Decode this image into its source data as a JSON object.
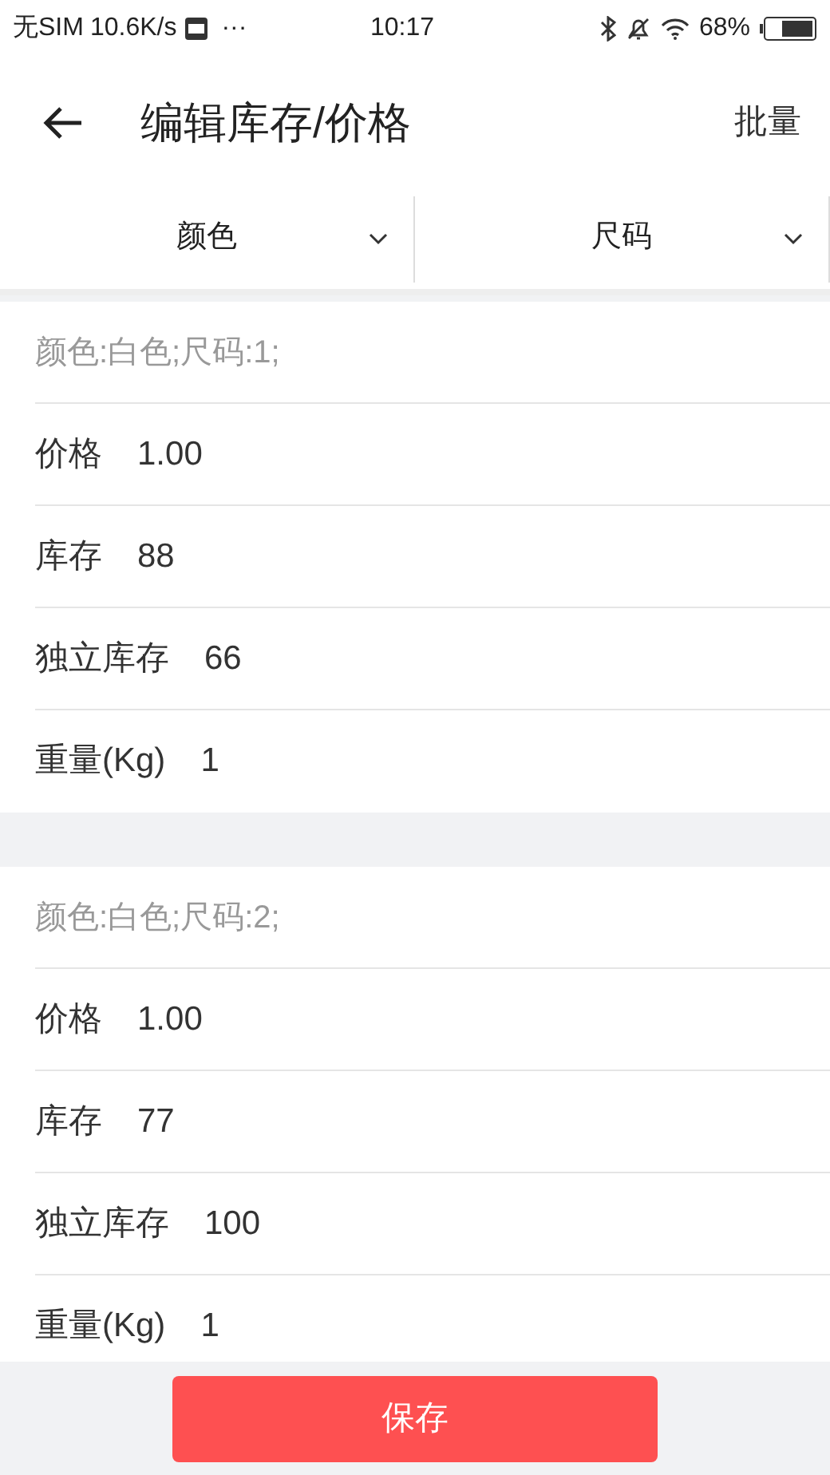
{
  "status_bar": {
    "carrier": "无SIM",
    "speed": "10.6K/s",
    "more": "···",
    "time": "10:17",
    "battery": "68%"
  },
  "header": {
    "title": "编辑库存/价格",
    "action": "批量"
  },
  "filters": [
    {
      "label": "颜色"
    },
    {
      "label": "尺码"
    }
  ],
  "skus": [
    {
      "title": "颜色:白色;尺码:1;",
      "fields": [
        {
          "label": "价格",
          "value": "1.00"
        },
        {
          "label": "库存",
          "value": "88"
        },
        {
          "label": "独立库存",
          "value": "66"
        },
        {
          "label": "重量(Kg)",
          "value": "1"
        }
      ]
    },
    {
      "title": "颜色:白色;尺码:2;",
      "fields": [
        {
          "label": "价格",
          "value": "1.00"
        },
        {
          "label": "库存",
          "value": "77"
        },
        {
          "label": "独立库存",
          "value": "100"
        },
        {
          "label": "重量(Kg)",
          "value": "1"
        }
      ]
    }
  ],
  "save_button": "保存"
}
